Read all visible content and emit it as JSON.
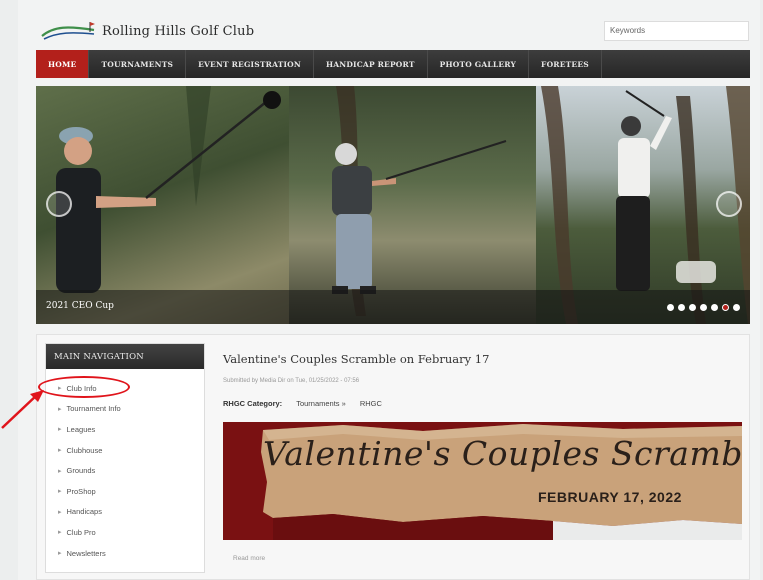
{
  "header": {
    "site_title": "Rolling Hills Golf Club",
    "search_placeholder": "Keywords"
  },
  "nav": {
    "items": [
      "HOME",
      "TOURNAMENTS",
      "EVENT REGISTRATION",
      "HANDICAP REPORT",
      "PHOTO GALLERY",
      "FORETEES"
    ],
    "active": "HOME"
  },
  "hero": {
    "caption": "2021 CEO Cup",
    "slide_count": 7,
    "active_slide": 6
  },
  "sidebar": {
    "title": "MAIN NAVIGATION",
    "items": [
      "Club Info",
      "Tournament Info",
      "Leagues",
      "Clubhouse",
      "Grounds",
      "ProShop",
      "Handicaps",
      "Club Pro",
      "Newsletters"
    ],
    "highlighted": "Club Info"
  },
  "article": {
    "title": "Valentine's Couples Scramble on February 17",
    "meta": "Submitted by Media Dir on Tue, 01/25/2022 - 07:56",
    "category_label": "RHGC Category:",
    "category_1": "Tournaments »",
    "category_2": "RHGC",
    "banner_title": "Valentine's Couples Scramble",
    "banner_date": "FEBRUARY 17, 2022",
    "read_more": "Read more"
  },
  "colors": {
    "accent": "#b3201b",
    "nav_bg": "#2e2e2e",
    "annotation": "#e0141b",
    "banner_red": "#7a1112",
    "paper": "#c9a27a"
  }
}
